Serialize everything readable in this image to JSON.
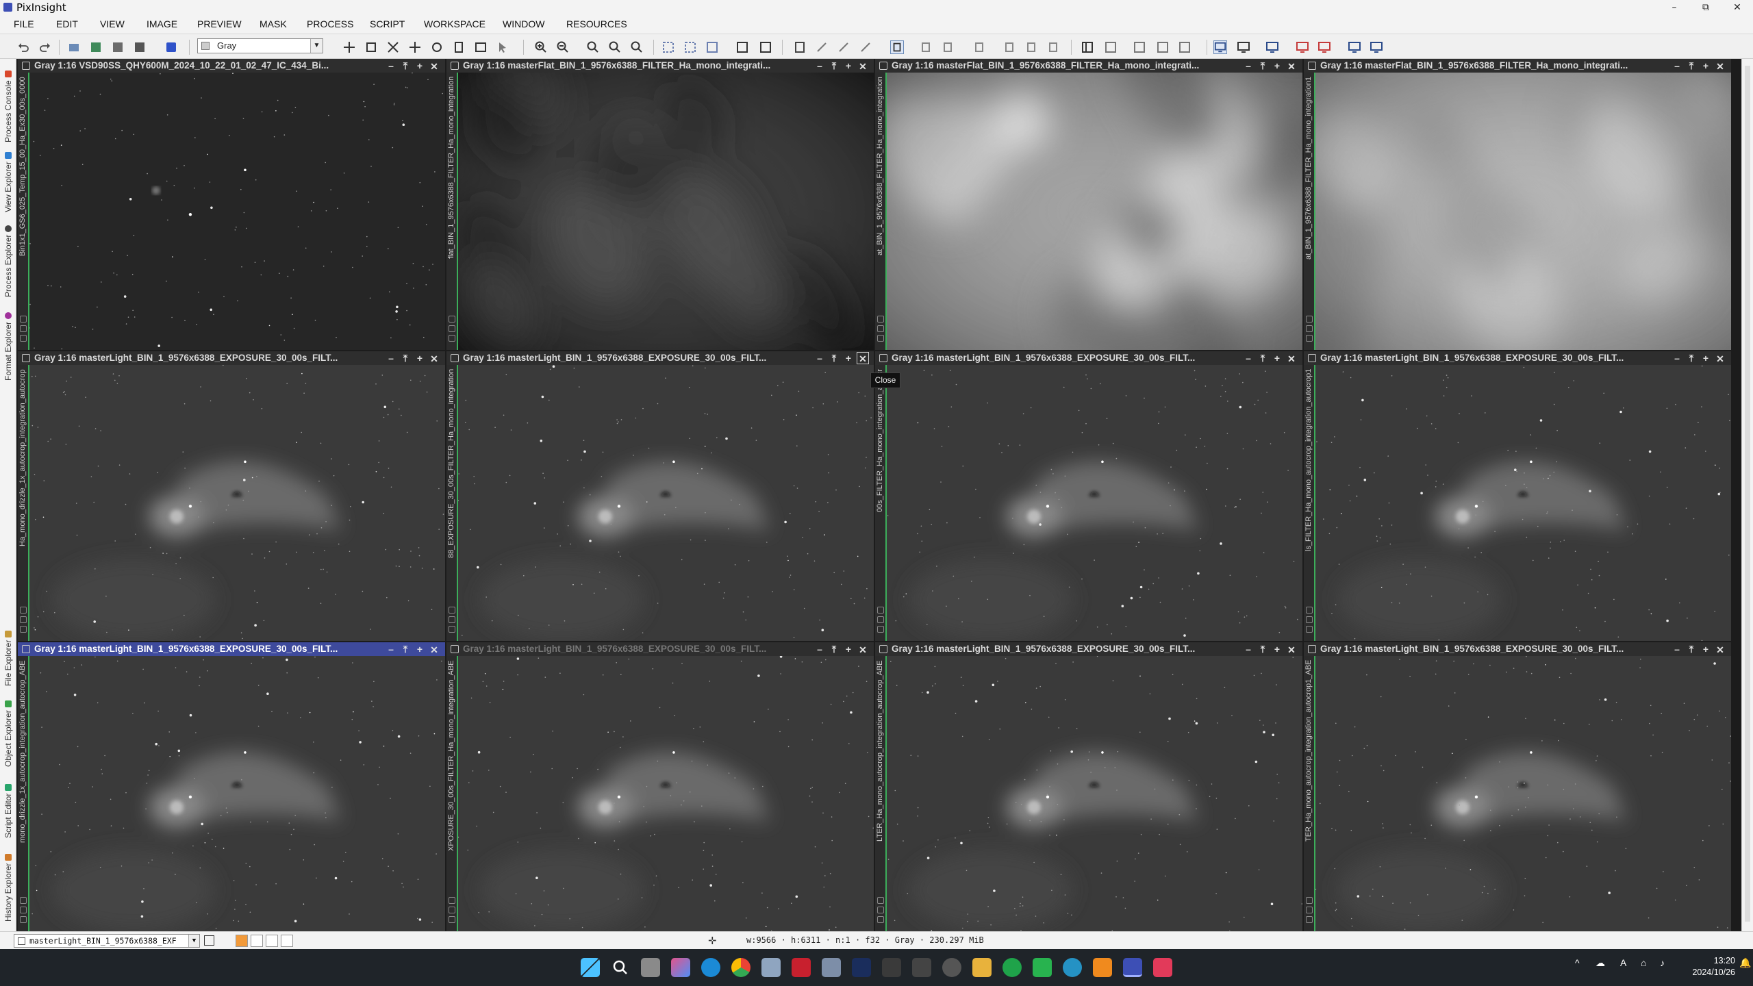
{
  "app": {
    "title": "PixInsight",
    "minimize": "–",
    "maximize": "⧉",
    "close": "✕"
  },
  "menu": [
    "FILE",
    "EDIT",
    "VIEW",
    "IMAGE",
    "PREVIEW",
    "MASK",
    "PROCESS",
    "SCRIPT",
    "WORKSPACE",
    "WINDOW",
    "RESOURCES"
  ],
  "toolbar": {
    "color_mode": "Gray"
  },
  "left_panels": [
    {
      "label": "Process Console",
      "color": "#d9482b"
    },
    {
      "label": "View Explorer",
      "color": "#2f7fd1"
    },
    {
      "label": "Process Explorer",
      "color": "#444444"
    },
    {
      "label": "Format Explorer",
      "color": "#a0319b"
    },
    {
      "label": "File Explorer",
      "color": "#c69a3a"
    },
    {
      "label": "Object Explorer",
      "color": "#39a24a"
    },
    {
      "label": "Script Editor",
      "color": "#28a56b"
    },
    {
      "label": "History Explorer",
      "color": "#d07a2a"
    }
  ],
  "windows": [
    {
      "title": "Gray 1:16 VSD90SS_QHY600M_2024_10_22_01_02_47_IC_434_Bi...",
      "side_id": "Bin1x1_GS6_025_Temp_15_00_Ha_Ex30_00s_0000",
      "kind": "light_raw"
    },
    {
      "title": "Gray 1:16 masterFlat_BIN_1_9576x6388_FILTER_Ha_mono_integrati...",
      "side_id": "flat_BIN_1_9576x6388_FILTER_Ha_mono_integration",
      "kind": "flat_dark"
    },
    {
      "title": "Gray 1:16 masterFlat_BIN_1_9576x6388_FILTER_Ha_mono_integrati...",
      "side_id": "at_BIN_1_9576x6388_FILTER_Ha_mono_integration",
      "kind": "flat_bright"
    },
    {
      "title": "Gray 1:16 masterFlat_BIN_1_9576x6388_FILTER_Ha_mono_integrati...",
      "side_id": "at_BIN_1_9576x6388_FILTER_Ha_mono_integration1",
      "kind": "flat_smooth"
    },
    {
      "title": "Gray 1:16 masterLight_BIN_1_9576x6388_EXPOSURE_30_00s_FILT...",
      "side_id": "Ha_mono_drizzle_1x_autocrop_integration_autocrop",
      "kind": "light"
    },
    {
      "title": "Gray 1:16 masterLight_BIN_1_9576x6388_EXPOSURE_30_00s_FILT...",
      "side_id": "88_EXPOSURE_30_00s_FILTER_Ha_mono_integration",
      "kind": "light"
    },
    {
      "title": "Gray 1:16 masterLight_BIN_1_9576x6388_EXPOSURE_30_00s_FILT...",
      "side_id": "00s_FILTER_Ha_mono_integration_autocr",
      "kind": "light"
    },
    {
      "title": "Gray 1:16 masterLight_BIN_1_9576x6388_EXPOSURE_30_00s_FILT...",
      "side_id": "ls_FILTER_Ha_mono_autocrop_integration_autocrop1",
      "kind": "light"
    },
    {
      "title": "Gray 1:16 masterLight_BIN_1_9576x6388_EXPOSURE_30_00s_FILT...",
      "side_id": "mono_drizzle_1x_autocrop_integration_autocrop_ABE",
      "kind": "light"
    },
    {
      "title": "Gray 1:16 masterLight_BIN_1_9576x6388_EXPOSURE_30_00s_FILT...",
      "side_id": "XPOSURE_30_00s_FILTER_Ha_mono_integration_ABE",
      "kind": "light"
    },
    {
      "title": "Gray 1:16 masterLight_BIN_1_9576x6388_EXPOSURE_30_00s_FILT...",
      "side_id": "LTER_Ha_mono_autocrop_integration_autocrop_ABE",
      "kind": "light"
    },
    {
      "title": "Gray 1:16 masterLight_BIN_1_9576x6388_EXPOSURE_30_00s_FILT...",
      "side_id": "TER_Ha_mono_autocrop_integration_autocrop1_ABE",
      "kind": "light"
    }
  ],
  "tooltip": "Close",
  "status": {
    "view": "masterLight_BIN_1_9576x6388_EXF",
    "info": "w:9566 · h:6311 · n:1 · f32 · Gray · 230.297 MiB"
  },
  "clock": {
    "time": "13:20",
    "date": "2024/10/26"
  }
}
